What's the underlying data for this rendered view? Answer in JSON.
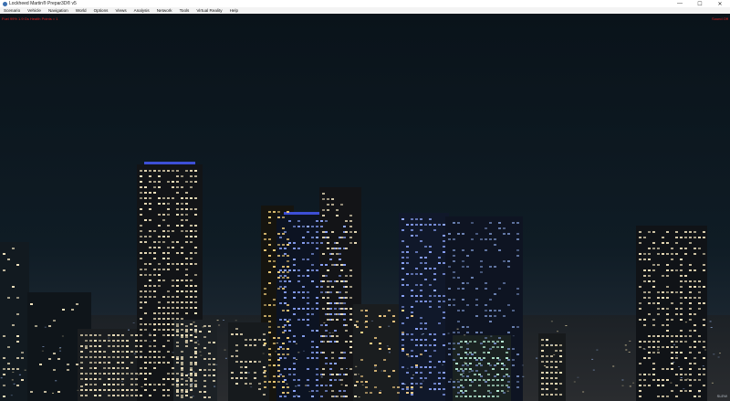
{
  "window": {
    "title": "Lockheed Martin® Prepar3D® v5",
    "controls": [
      "—",
      "☐",
      "✕"
    ]
  },
  "menu": [
    "Scenario",
    "Vehicle",
    "Navigation",
    "World",
    "Options",
    "Views",
    "Analysis",
    "Network",
    "Tools",
    "Virtual Reality",
    "Help"
  ],
  "hud": {
    "left": "Fuel 99%   1.9 Gs  Health Points = 1",
    "right": "Sound Off"
  },
  "scene": {
    "type": "night city skyline",
    "colors": {
      "sky": "#0b141b",
      "window_light": "#f4e6c0",
      "blue_light": "#8fa8ff",
      "roof_glow": "#3d4fd6",
      "hud_text": "#e02020"
    }
  },
  "corner_label": "SLEW"
}
